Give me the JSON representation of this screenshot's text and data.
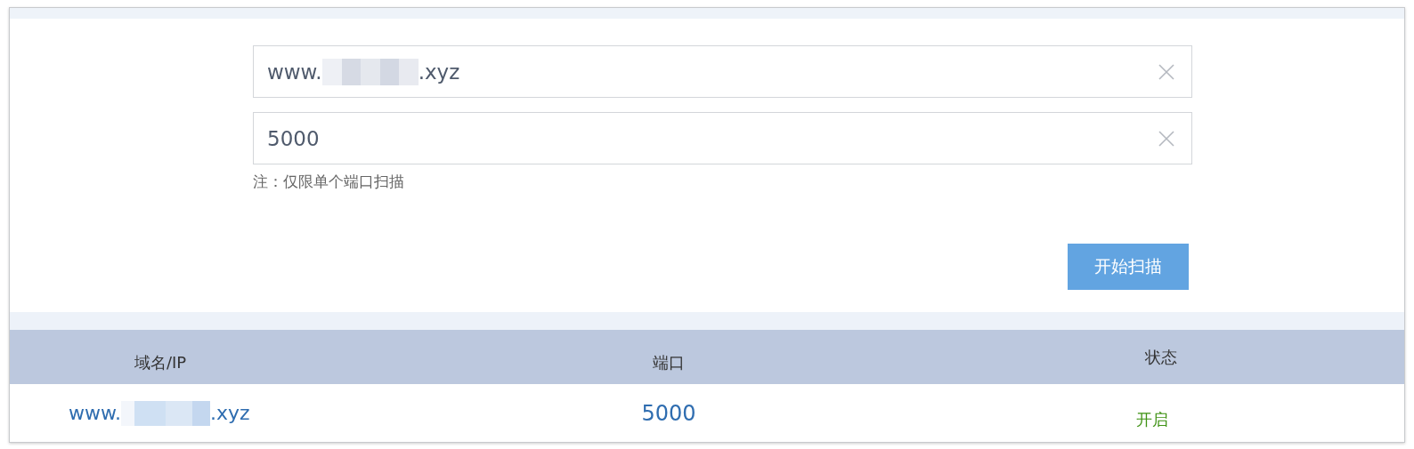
{
  "form": {
    "host_field": {
      "value_start": "www.",
      "value_end": ".xyz",
      "redacted": true
    },
    "port_field": {
      "value": "5000"
    },
    "note": "注：仅限单个端口扫描",
    "scan_button": "开始扫描"
  },
  "table": {
    "columns": [
      "域名/IP",
      "端口",
      "状态"
    ],
    "rows": [
      {
        "host_start": "www.",
        "host_end": ".xyz",
        "redacted": true,
        "port": "5000",
        "status": "开启",
        "open": true
      }
    ]
  }
}
